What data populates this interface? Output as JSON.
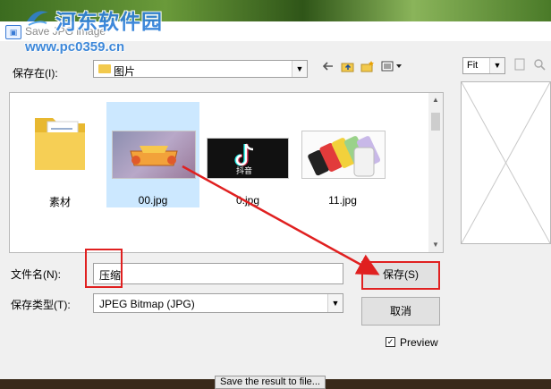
{
  "watermark": {
    "name": "河东软件园",
    "url": "www.pc0359.cn"
  },
  "window": {
    "title": "Save JPG image"
  },
  "location": {
    "label": "保存在(I):",
    "folder": "图片"
  },
  "toolbar": {
    "back_icon": "back-arrow-icon",
    "up_icon": "folder-up-icon",
    "new_folder_icon": "new-folder-icon",
    "view_icon": "view-menu-icon"
  },
  "files": [
    {
      "name": "素材",
      "type": "folder"
    },
    {
      "name": "00.jpg",
      "type": "image",
      "selected": true
    },
    {
      "name": "0.jpg",
      "type": "image",
      "thumb_text": "抖音"
    },
    {
      "name": "11.jpg",
      "type": "image"
    }
  ],
  "filename": {
    "label": "文件名(N):",
    "value": "压缩"
  },
  "filetype": {
    "label": "保存类型(T):",
    "value": "JPEG Bitmap (JPG)"
  },
  "buttons": {
    "save": "保存(S)",
    "cancel": "取消"
  },
  "preview": {
    "zoom": "Fit",
    "checkbox_label": "Preview",
    "checked": true
  },
  "footer": {
    "button": "Save the result to file..."
  },
  "colors": {
    "accent": "#0078d7",
    "annotation": "#e02020",
    "watermark": "#2f80d8"
  }
}
